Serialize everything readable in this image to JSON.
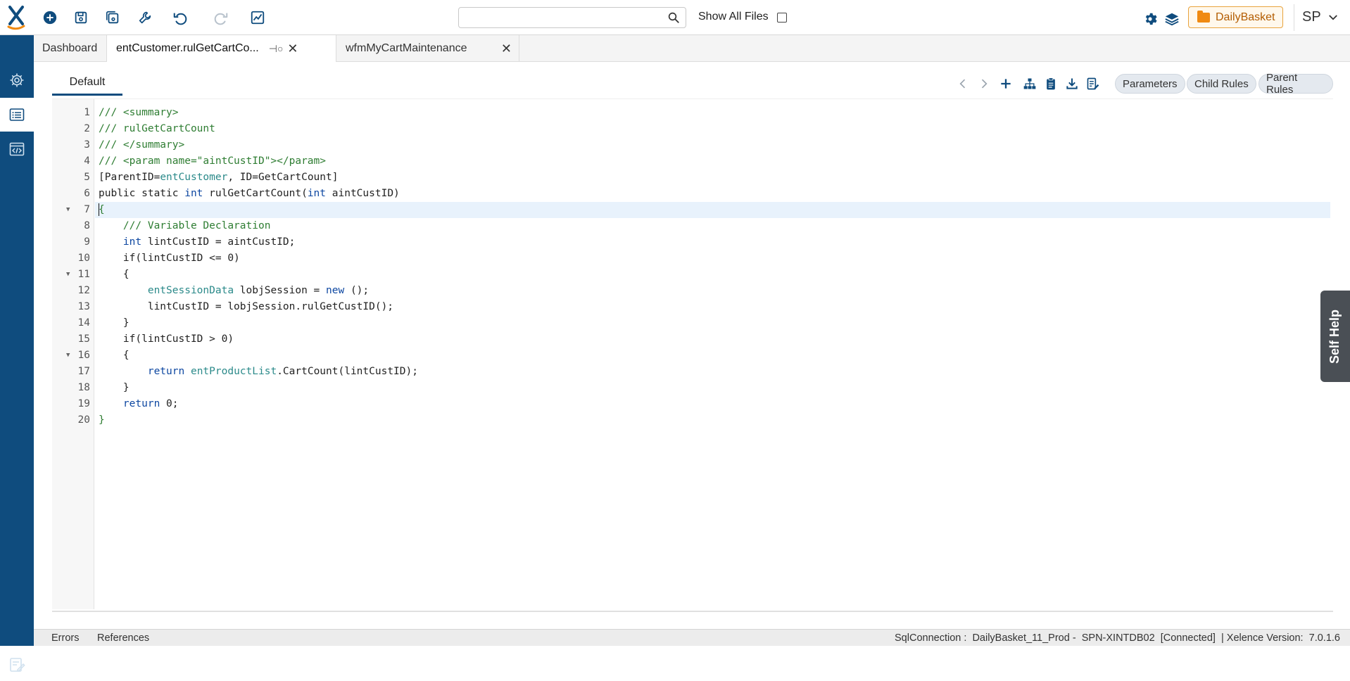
{
  "toolbar": {
    "search": {
      "value": "",
      "placeholder": ""
    },
    "show_all_files_label": "Show All Files",
    "show_all_files_checked": false,
    "project_label": "DailyBasket",
    "user_initials": "SP"
  },
  "tabs": [
    {
      "label": "Dashboard",
      "active": false
    },
    {
      "label": "entCustomer.rulGetCartCo...",
      "active": true,
      "pinned": true
    },
    {
      "label": "wfmMyCartMaintenance",
      "active": false
    }
  ],
  "panel": {
    "subtab_label": "Default",
    "pills": [
      "Parameters",
      "Child Rules",
      "Parent Rules"
    ]
  },
  "code": {
    "current_line": 7,
    "lines": [
      {
        "n": "1",
        "text": "/// <summary>"
      },
      {
        "n": "2",
        "text": "/// rulGetCartCount"
      },
      {
        "n": "3",
        "text": "/// </summary>"
      },
      {
        "n": "4",
        "text": "/// <param name=\"aintCustID\"></param>"
      },
      {
        "n": "5",
        "text": "[ParentID=entCustomer, ID=GetCartCount]"
      },
      {
        "n": "6",
        "text": "public static int rulGetCartCount(int aintCustID)"
      },
      {
        "n": "7",
        "text": "{"
      },
      {
        "n": "8",
        "text": "    /// Variable Declaration"
      },
      {
        "n": "9",
        "text": "    int lintCustID = aintCustID;"
      },
      {
        "n": "10",
        "text": "    if(lintCustID <= 0)"
      },
      {
        "n": "11",
        "text": "    {"
      },
      {
        "n": "12",
        "text": "        entSessionData lobjSession = new ();"
      },
      {
        "n": "13",
        "text": "        lintCustID = lobjSession.rulGetCustID();"
      },
      {
        "n": "14",
        "text": "    }"
      },
      {
        "n": "15",
        "text": "    if(lintCustID > 0)"
      },
      {
        "n": "16",
        "text": "    {"
      },
      {
        "n": "17",
        "text": "        return entProductList.CartCount(lintCustID);"
      },
      {
        "n": "18",
        "text": "    }"
      },
      {
        "n": "19",
        "text": "    return 0;"
      },
      {
        "n": "20",
        "text": "}"
      }
    ],
    "fold_lines": [
      7,
      11,
      16
    ]
  },
  "self_help_label": "Self Help",
  "status": {
    "errors_label": "Errors",
    "references_label": "References",
    "connection_text": "SqlConnection :  DailyBasket_11_Prod -  SPN-XINTDB02  [Connected]  | Xelence Version:  7.0.1.6"
  }
}
